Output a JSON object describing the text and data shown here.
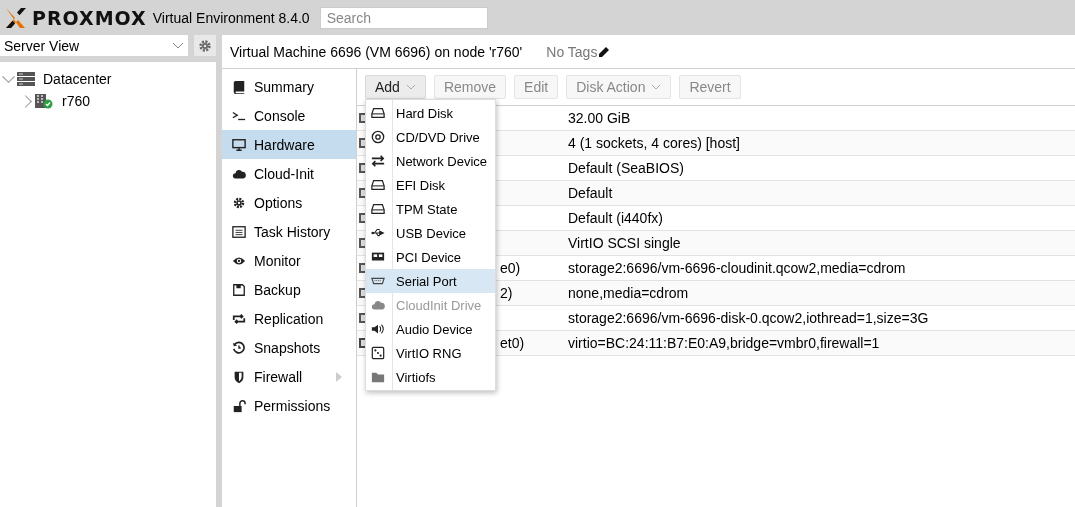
{
  "header": {
    "product": "PROXMOX",
    "subtitle": "Virtual Environment 8.4.0",
    "search": {
      "placeholder": "Search"
    }
  },
  "sidebar": {
    "view": "Server View",
    "tree": [
      {
        "label": "Datacenter",
        "expanded": true,
        "children": [
          {
            "label": "r760",
            "expanded": false
          }
        ]
      }
    ]
  },
  "title": {
    "text": "Virtual Machine 6696 (VM 6696) on node 'r760'",
    "tags": "No Tags"
  },
  "nav": [
    {
      "label": "Summary",
      "selected": false
    },
    {
      "label": "Console",
      "selected": false
    },
    {
      "label": "Hardware",
      "selected": true
    },
    {
      "label": "Cloud-Init",
      "selected": false
    },
    {
      "label": "Options",
      "selected": false
    },
    {
      "label": "Task History",
      "selected": false
    },
    {
      "label": "Monitor",
      "selected": false
    },
    {
      "label": "Backup",
      "selected": false
    },
    {
      "label": "Replication",
      "selected": false
    },
    {
      "label": "Snapshots",
      "selected": false
    },
    {
      "label": "Firewall",
      "selected": false,
      "has_submenu": true
    },
    {
      "label": "Permissions",
      "selected": false
    }
  ],
  "toolbar": [
    {
      "label": "Add",
      "disabled": false,
      "dropdown": true
    },
    {
      "label": "Remove",
      "disabled": true
    },
    {
      "label": "Edit",
      "disabled": true
    },
    {
      "label": "Disk Action",
      "disabled": true,
      "dropdown": true
    },
    {
      "label": "Revert",
      "disabled": true
    }
  ],
  "hardware_rows": [
    {
      "value": "32.00 GiB"
    },
    {
      "value": "4 (1 sockets, 4 cores) [host]"
    },
    {
      "value": "Default (SeaBIOS)"
    },
    {
      "value": "Default"
    },
    {
      "value": "Default (i440fx)"
    },
    {
      "value": "VirtIO SCSI single"
    },
    {
      "column_1": "e0)",
      "value": "storage2:6696/vm-6696-cloudinit.qcow2,media=cdrom"
    },
    {
      "column_1": "2)",
      "value": "none,media=cdrom"
    },
    {
      "value": "storage2:6696/vm-6696-disk-0.qcow2,iothread=1,size=3G"
    },
    {
      "column_1": "et0)",
      "value": "virtio=BC:24:11:B7:E0:A9,bridge=vmbr0,firewall=1"
    }
  ],
  "add_menu": [
    {
      "label": "Hard Disk",
      "selected": false,
      "disabled": false
    },
    {
      "label": "CD/DVD Drive",
      "selected": false,
      "disabled": false
    },
    {
      "label": "Network Device",
      "selected": false,
      "disabled": false
    },
    {
      "label": "EFI Disk",
      "selected": false,
      "disabled": false
    },
    {
      "label": "TPM State",
      "selected": false,
      "disabled": false
    },
    {
      "label": "USB Device",
      "selected": false,
      "disabled": false
    },
    {
      "label": "PCI Device",
      "selected": false,
      "disabled": false
    },
    {
      "label": "Serial Port",
      "selected": true,
      "disabled": false
    },
    {
      "label": "CloudInit Drive",
      "selected": false,
      "disabled": true
    },
    {
      "label": "Audio Device",
      "selected": false,
      "disabled": false
    },
    {
      "label": "VirtIO RNG",
      "selected": false,
      "disabled": false
    },
    {
      "label": "Virtiofs",
      "selected": false,
      "disabled": false
    }
  ]
}
